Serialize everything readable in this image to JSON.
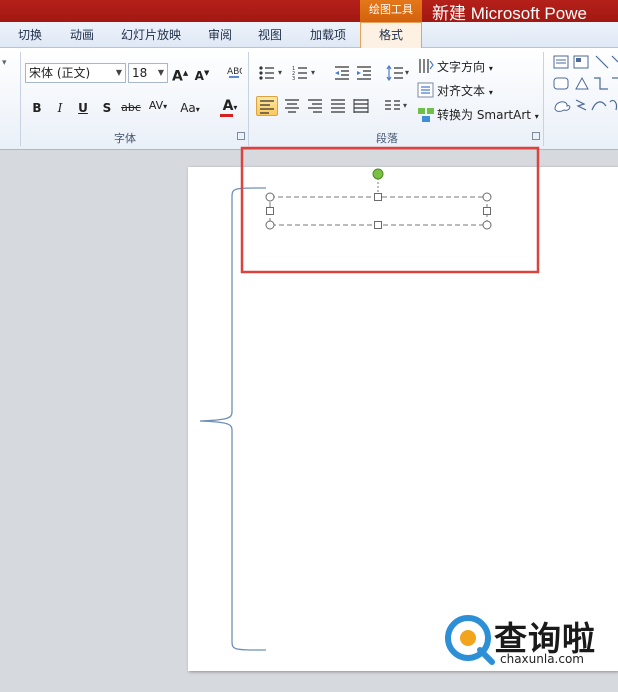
{
  "window": {
    "context_group": "绘图工具",
    "title": "新建 Microsoft Powe"
  },
  "tabs": [
    {
      "label": "切换"
    },
    {
      "label": "动画"
    },
    {
      "label": "幻灯片放映"
    },
    {
      "label": "审阅"
    },
    {
      "label": "视图"
    },
    {
      "label": "加载项"
    },
    {
      "label": "格式",
      "active": true
    }
  ],
  "font_group": {
    "label": "字体",
    "font_name": "宋体 (正文)",
    "font_size": "18",
    "grow": "A",
    "shrink": "A",
    "bold": "B",
    "italic": "I",
    "underline": "U",
    "shadow": "S",
    "strike": "abc",
    "spacing": "AV",
    "case": "Aa",
    "color": "A",
    "font_color_hex": "#d42020"
  },
  "paragraph_group": {
    "label": "段落",
    "text_direction": "文字方向",
    "align_text": "对齐文本",
    "smartart": "转换为 SmartArt"
  },
  "watermark": {
    "text": "查询啦",
    "domain": "chaxunla.com"
  },
  "colors": {
    "accent_red": "#d9443e",
    "active_tab_border": "#e8a25c",
    "selection_green": "#7bc043",
    "brace_blue": "#6f8fb8",
    "watermark_blue": "#2d8fd6"
  }
}
